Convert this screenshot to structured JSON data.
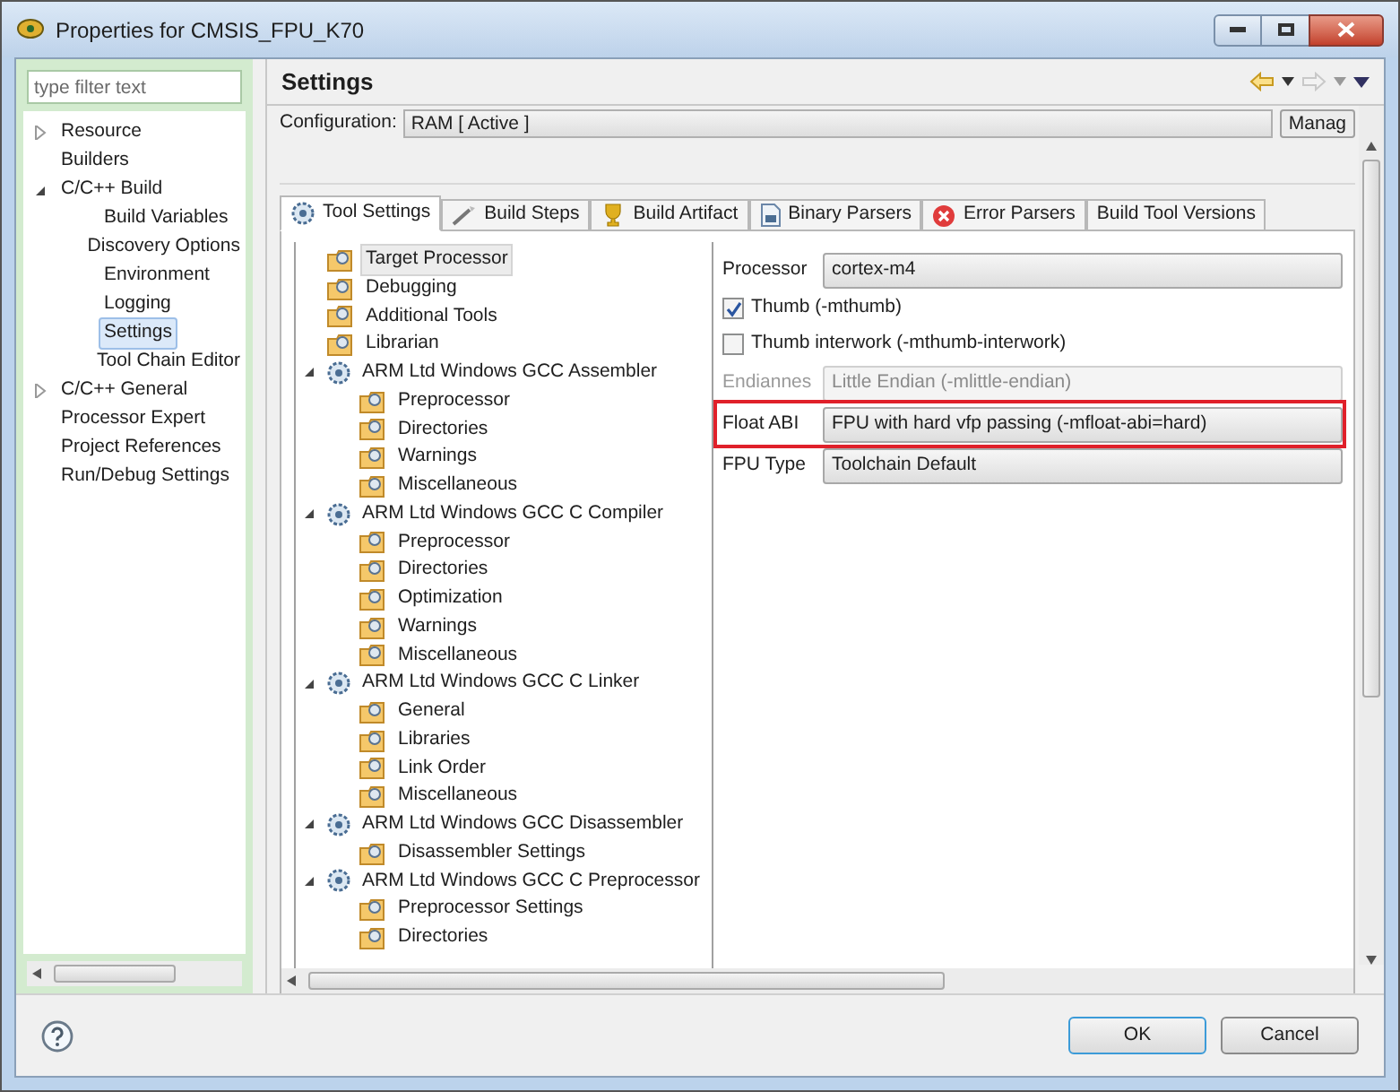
{
  "window": {
    "title": "Properties for CMSIS_FPU_K70"
  },
  "filter": {
    "placeholder": "type filter text"
  },
  "sidebar": {
    "items": [
      {
        "label": "Resource",
        "selected": false,
        "expanded": false
      },
      {
        "label": "Builders",
        "selected": false
      },
      {
        "label": "C/C++ Build",
        "selected": false,
        "expanded": true,
        "children": [
          {
            "label": "Build Variables",
            "selected": false
          },
          {
            "label": "Discovery Options",
            "selected": false
          },
          {
            "label": "Environment",
            "selected": false
          },
          {
            "label": "Logging",
            "selected": false
          },
          {
            "label": "Settings",
            "selected": true
          },
          {
            "label": "Tool Chain Editor",
            "selected": false
          }
        ]
      },
      {
        "label": "C/C++ General",
        "selected": false,
        "expanded": false
      },
      {
        "label": "Processor Expert",
        "selected": false
      },
      {
        "label": "Project References",
        "selected": false
      },
      {
        "label": "Run/Debug Settings",
        "selected": false
      }
    ]
  },
  "page": {
    "title": "Settings"
  },
  "configuration": {
    "label": "Configuration:",
    "value": "RAM [ Active ]",
    "button": "Manag"
  },
  "tabs": [
    {
      "label": "Tool Settings",
      "kind": "gear",
      "selected": true
    },
    {
      "label": "Build Steps",
      "kind": "wand",
      "selected": false
    },
    {
      "label": "Build Artifact",
      "kind": "trophy",
      "selected": false
    },
    {
      "label": "Binary Parsers",
      "kind": "binary",
      "selected": false
    },
    {
      "label": "Error Parsers",
      "kind": "error",
      "selected": false
    },
    {
      "label": "Build Tool Versions",
      "kind": "none",
      "selected": false
    }
  ],
  "tool_tree": [
    {
      "label": "Target Processor",
      "kind": "option",
      "selected": true
    },
    {
      "label": "Debugging",
      "kind": "option",
      "selected": false
    },
    {
      "label": "Additional Tools",
      "kind": "option",
      "selected": false
    },
    {
      "label": "Librarian",
      "kind": "option",
      "selected": false
    },
    {
      "label": "ARM Ltd Windows GCC Assembler",
      "kind": "tool",
      "selected": false,
      "expanded": true,
      "children": [
        {
          "label": "Preprocessor",
          "kind": "option",
          "selected": false
        },
        {
          "label": "Directories",
          "kind": "option",
          "selected": false
        },
        {
          "label": "Warnings",
          "kind": "option",
          "selected": false
        },
        {
          "label": "Miscellaneous",
          "kind": "option",
          "selected": false
        }
      ]
    },
    {
      "label": "ARM Ltd Windows GCC C Compiler",
      "kind": "tool",
      "selected": false,
      "expanded": true,
      "children": [
        {
          "label": "Preprocessor",
          "kind": "option",
          "selected": false
        },
        {
          "label": "Directories",
          "kind": "option",
          "selected": false
        },
        {
          "label": "Optimization",
          "kind": "option",
          "selected": false
        },
        {
          "label": "Warnings",
          "kind": "option",
          "selected": false
        },
        {
          "label": "Miscellaneous",
          "kind": "option",
          "selected": false
        }
      ]
    },
    {
      "label": "ARM Ltd Windows GCC C Linker",
      "kind": "tool",
      "selected": false,
      "expanded": true,
      "children": [
        {
          "label": "General",
          "kind": "option",
          "selected": false
        },
        {
          "label": "Libraries",
          "kind": "option",
          "selected": false
        },
        {
          "label": "Link Order",
          "kind": "option",
          "selected": false
        },
        {
          "label": "Miscellaneous",
          "kind": "option",
          "selected": false
        }
      ]
    },
    {
      "label": "ARM Ltd Windows GCC Disassembler",
      "kind": "tool",
      "selected": false,
      "expanded": true,
      "children": [
        {
          "label": "Disassembler Settings",
          "kind": "option",
          "selected": false
        }
      ]
    },
    {
      "label": "ARM Ltd Windows GCC C Preprocessor",
      "kind": "tool",
      "selected": false,
      "expanded": true,
      "children": [
        {
          "label": "Preprocessor Settings",
          "kind": "option",
          "selected": false
        },
        {
          "label": "Directories",
          "kind": "option",
          "selected": false
        }
      ]
    }
  ],
  "properties": [
    {
      "kind": "select",
      "label": "Processor",
      "value": "cortex-m4",
      "disabled": false,
      "highlighted": false
    },
    {
      "kind": "checkbox",
      "label": "Thumb (-mthumb)",
      "checked": true
    },
    {
      "kind": "checkbox",
      "label": "Thumb interwork (-mthumb-interwork)",
      "checked": false
    },
    {
      "kind": "select",
      "label": "Endiannes",
      "value": "Little Endian (-mlittle-endian)",
      "disabled": true,
      "highlighted": false
    },
    {
      "kind": "select",
      "label": "Float ABI",
      "value": "FPU with hard vfp passing (-mfloat-abi=hard)",
      "disabled": false,
      "highlighted": true
    },
    {
      "kind": "select",
      "label": "FPU Type",
      "value": "Toolchain Default",
      "disabled": false,
      "highlighted": false
    }
  ],
  "buttons": [
    {
      "label": "OK",
      "kind": "default"
    },
    {
      "label": "Cancel",
      "kind": "normal"
    }
  ]
}
